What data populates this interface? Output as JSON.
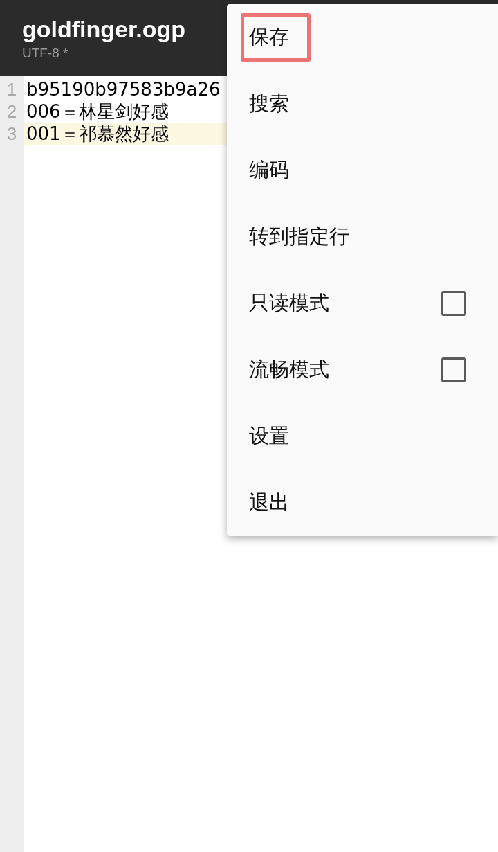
{
  "header": {
    "title": "goldfinger.ogp",
    "subtitle": "UTF-8 *"
  },
  "editor": {
    "lines": [
      {
        "number": "1",
        "text": "b95190b97583b9a26",
        "current": false
      },
      {
        "number": "2",
        "text": "006＝林星剑好感",
        "current": false
      },
      {
        "number": "3",
        "text": "001＝祁慕然好感",
        "current": true
      }
    ]
  },
  "menu": {
    "items": [
      {
        "label": "保存",
        "kind": "action",
        "highlighted": true
      },
      {
        "label": "搜索",
        "kind": "action",
        "highlighted": false
      },
      {
        "label": "编码",
        "kind": "action",
        "highlighted": false
      },
      {
        "label": "转到指定行",
        "kind": "action",
        "highlighted": false
      },
      {
        "label": "只读模式",
        "kind": "toggle",
        "checked": false,
        "highlighted": false
      },
      {
        "label": "流畅模式",
        "kind": "toggle",
        "checked": false,
        "highlighted": false
      },
      {
        "label": "设置",
        "kind": "action",
        "highlighted": false
      },
      {
        "label": "退出",
        "kind": "action",
        "highlighted": false
      }
    ]
  }
}
